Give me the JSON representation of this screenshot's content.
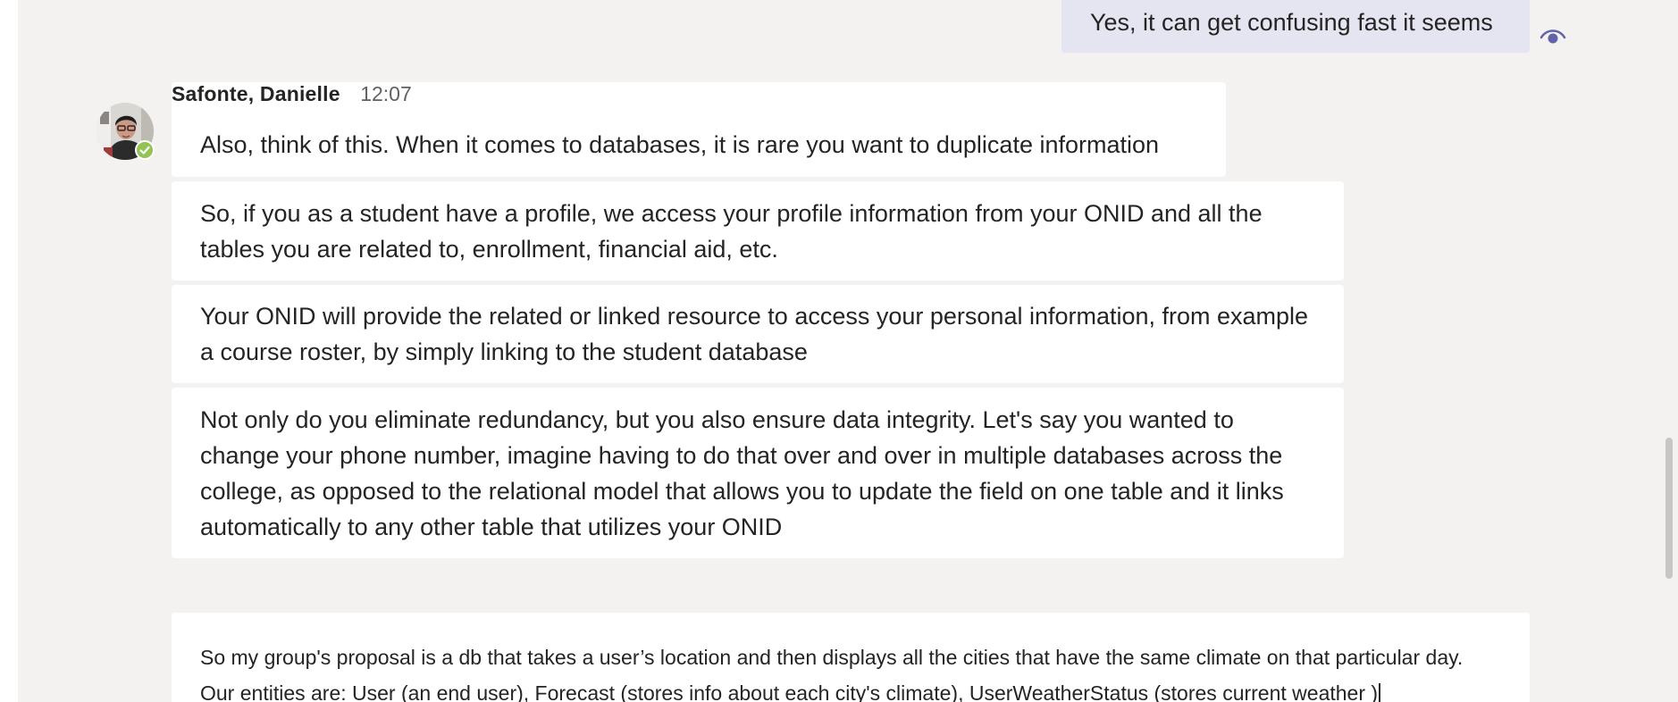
{
  "thread": {
    "sent_message": {
      "text": "Yes, it can get confusing fast it seems",
      "status_icon": "eye-icon"
    },
    "received_group": {
      "author": "Safonte, Danielle",
      "time": "12:07",
      "presence": "available",
      "presence_color": "#92c353",
      "messages": [
        "Also, think of this. When it comes to databases, it is rare you want to duplicate information",
        "So, if you as a student have a profile, we access your profile information from your ONID and all the tables you are related to, enrollment, financial aid, etc.",
        "Your ONID will provide the related or linked resource to access your personal information, from example a course roster, by simply linking to the student database",
        "Not only do you eliminate redundancy, but you also ensure data integrity. Let's say you wanted to change your phone number, imagine having to do that over and over in multiple databases across the college, as opposed to the relational model that allows you to update the field on one table and it links automatically to any other table that utilizes your ONID"
      ]
    }
  },
  "compose": {
    "line1": "So my group's proposal is a db that takes a user’s location and then displays all the cities that have the same climate on that particular day.",
    "line2": "Our entities are: User (an end user), Forecast (stores info about each city's climate), UserWeatherStatus (stores current weather )"
  },
  "colors": {
    "background": "#f3f2f1",
    "sent_bubble": "#e5e5f1",
    "received_bubble": "#ffffff",
    "accent": "#6264a7"
  }
}
